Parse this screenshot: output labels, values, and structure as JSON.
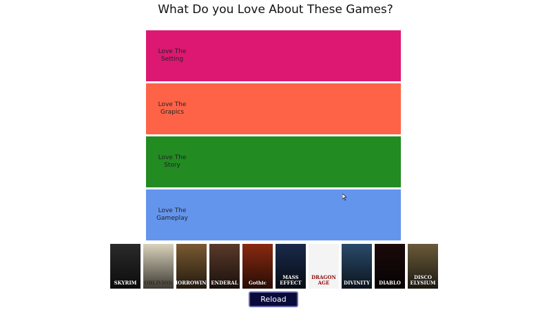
{
  "title": "What Do you Love About These Games?",
  "tiers": [
    {
      "label": "Love The\nSetting",
      "color": "#dc1872"
    },
    {
      "label": "Love The\nGrapics",
      "color": "#ff6347"
    },
    {
      "label": "Love The\nStory",
      "color": "#228b22"
    },
    {
      "label": "Love The\nGameplay",
      "color": "#6495ed"
    }
  ],
  "games": [
    {
      "title": "SKYRIM",
      "color": "#2a2a2a",
      "icon": "skyrim-cover-icon"
    },
    {
      "title": "OBLIVION",
      "color": "#d9d2bc",
      "icon": "oblivion-cover-icon"
    },
    {
      "title": "MORROWIND",
      "color": "#7a5a32",
      "icon": "morrowind-cover-icon"
    },
    {
      "title": "ENDERAL",
      "color": "#5a3a2a",
      "icon": "enderal-cover-icon"
    },
    {
      "title": "Gothic",
      "color": "#8a2a10",
      "icon": "gothic-cover-icon"
    },
    {
      "title": "MASS EFFECT",
      "color": "#1a2a4a",
      "icon": "mass-effect-cover-icon"
    },
    {
      "title": "DRAGON AGE",
      "color": "#f2f2f2",
      "icon": "dragon-age-cover-icon"
    },
    {
      "title": "DIVINITY",
      "color": "#2a4a6a",
      "icon": "divinity-cover-icon"
    },
    {
      "title": "DIABLO",
      "color": "#1a0a0a",
      "icon": "diablo-cover-icon"
    },
    {
      "title": "DISCO ELYSIUM",
      "color": "#6a5a3a",
      "icon": "disco-elysium-cover-icon"
    }
  ],
  "reload_label": "Reload"
}
